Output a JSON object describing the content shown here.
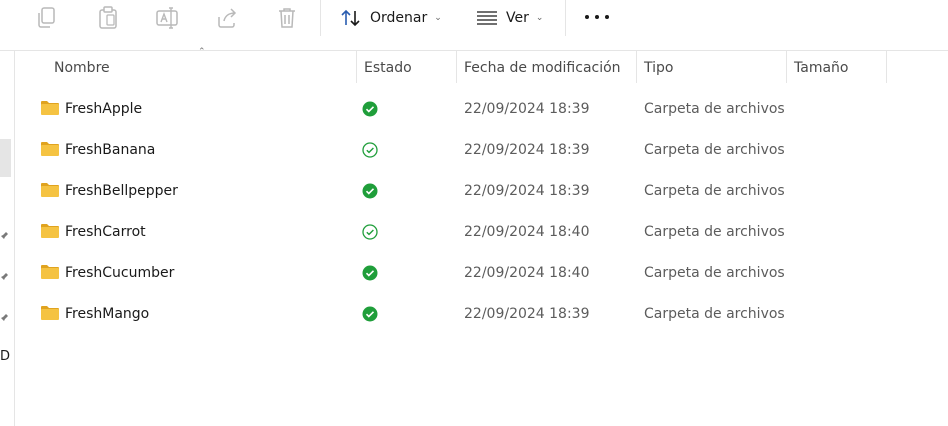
{
  "toolbar": {
    "icons": [
      "copy-icon",
      "paste-icon",
      "rename-icon",
      "share-icon",
      "delete-icon"
    ],
    "sort_label": "Ordenar",
    "view_label": "Ver",
    "more_icon": "more-options-icon"
  },
  "columns": {
    "name": "Nombre",
    "status": "Estado",
    "modified": "Fecha de modificación",
    "type": "Tipo",
    "size": "Tamaño"
  },
  "files": [
    {
      "name": "FreshApple",
      "status": "available-offline",
      "modified": "22/09/2024 18:39",
      "type": "Carpeta de archivos",
      "size": ""
    },
    {
      "name": "FreshBanana",
      "status": "available-online",
      "modified": "22/09/2024 18:39",
      "type": "Carpeta de archivos",
      "size": ""
    },
    {
      "name": "FreshBellpepper",
      "status": "available-offline",
      "modified": "22/09/2024 18:39",
      "type": "Carpeta de archivos",
      "size": ""
    },
    {
      "name": "FreshCarrot",
      "status": "available-online",
      "modified": "22/09/2024 18:40",
      "type": "Carpeta de archivos",
      "size": ""
    },
    {
      "name": "FreshCucumber",
      "status": "available-offline",
      "modified": "22/09/2024 18:40",
      "type": "Carpeta de archivos",
      "size": ""
    },
    {
      "name": "FreshMango",
      "status": "available-offline",
      "modified": "22/09/2024 18:39",
      "type": "Carpeta de archivos",
      "size": ""
    }
  ],
  "left_pane": {
    "truncated_char": "D"
  },
  "colors": {
    "status_green": "#1f9e3a",
    "folder_yellow": "#f5c342",
    "disabled_icon": "#b9b9b9",
    "accent_blue": "#2a5db0"
  }
}
